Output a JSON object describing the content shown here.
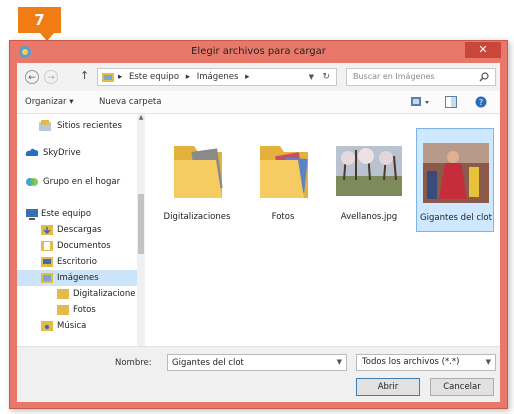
{
  "step": {
    "number": "7"
  },
  "window": {
    "title": "Elegir archivos para cargar",
    "close_label": "✕"
  },
  "address": {
    "back": "←",
    "forward": "→",
    "up": "↑",
    "breadcrumbs": [
      "Este equipo",
      "Imágenes"
    ],
    "search_placeholder": "Buscar en Imágenes"
  },
  "toolbar": {
    "organize": "Organizar ▾",
    "new_folder": "Nueva carpeta"
  },
  "sidebar": {
    "items": [
      {
        "label": "Sitios recientes",
        "icon": "recent-places-icon"
      },
      {
        "label": "SkyDrive",
        "icon": "skydrive-icon"
      },
      {
        "label": "Grupo en el hogar",
        "icon": "homegroup-icon"
      },
      {
        "label": "Este equipo",
        "icon": "computer-icon"
      },
      {
        "label": "Descargas",
        "icon": "folder-icon"
      },
      {
        "label": "Documentos",
        "icon": "folder-icon"
      },
      {
        "label": "Escritorio",
        "icon": "folder-icon"
      },
      {
        "label": "Imágenes",
        "icon": "folder-icon"
      },
      {
        "label": "Digitalizacione",
        "icon": "folder-icon"
      },
      {
        "label": "Fotos",
        "icon": "folder-icon"
      },
      {
        "label": "Música",
        "icon": "folder-icon"
      }
    ]
  },
  "files": [
    {
      "name": "Digitalizaciones",
      "kind": "folder"
    },
    {
      "name": "Fotos",
      "kind": "folder"
    },
    {
      "name": "Avellanos.jpg",
      "kind": "image"
    },
    {
      "name": "Gigantes del clot",
      "kind": "image",
      "selected": true
    }
  ],
  "footer": {
    "filename_label": "Nombre:",
    "filename_value": "Gigantes del clot",
    "filter_value": "Todos los archivos (*.*)",
    "open_label": "Abrir",
    "cancel_label": "Cancelar"
  },
  "colors": {
    "titlebar": "#e8796a",
    "accent": "#f07c14",
    "selection": "#cde8ff",
    "close": "#c9463b"
  }
}
